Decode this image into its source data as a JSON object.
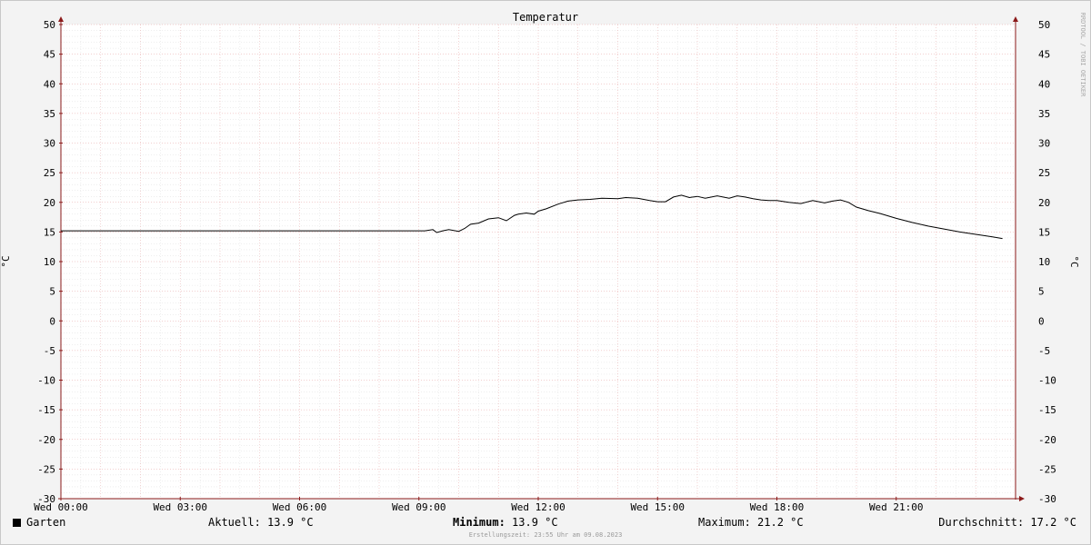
{
  "chart_data": {
    "type": "line",
    "title": "Temperatur",
    "ylabel": "°C",
    "ylabel_right": "°C",
    "ylim": [
      -30,
      50
    ],
    "yticks": [
      50,
      45,
      40,
      35,
      30,
      25,
      20,
      15,
      10,
      5,
      0,
      -5,
      -10,
      -15,
      -20,
      -25,
      -30
    ],
    "xlim_hours": [
      0,
      24
    ],
    "xticks": [
      {
        "h": 0,
        "label": "Wed 00:00"
      },
      {
        "h": 3,
        "label": "Wed 03:00"
      },
      {
        "h": 6,
        "label": "Wed 06:00"
      },
      {
        "h": 9,
        "label": "Wed 09:00"
      },
      {
        "h": 12,
        "label": "Wed 12:00"
      },
      {
        "h": 15,
        "label": "Wed 15:00"
      },
      {
        "h": 18,
        "label": "Wed 18:00"
      },
      {
        "h": 21,
        "label": "Wed 21:00"
      }
    ],
    "grid": true,
    "watermark": "RRDTOOL / TOBI OETIKER",
    "series": [
      {
        "name": "Garten",
        "color": "#000000",
        "x": [
          0,
          9.15,
          9.35,
          9.45,
          9.6,
          9.75,
          10.0,
          10.15,
          10.3,
          10.5,
          10.75,
          11.0,
          11.2,
          11.4,
          11.5,
          11.7,
          11.9,
          12.0,
          12.2,
          12.5,
          12.75,
          13.0,
          13.3,
          13.6,
          14.0,
          14.2,
          14.5,
          14.8,
          15.0,
          15.2,
          15.4,
          15.6,
          15.8,
          16.0,
          16.2,
          16.5,
          16.8,
          17.0,
          17.2,
          17.4,
          17.6,
          17.8,
          18.0,
          18.3,
          18.6,
          18.9,
          19.2,
          19.4,
          19.6,
          19.8,
          20.0,
          20.3,
          20.6,
          21.0,
          21.4,
          21.8,
          22.2,
          22.6,
          23.0,
          23.4,
          23.67
        ],
        "values": [
          15.2,
          15.2,
          15.4,
          14.9,
          15.2,
          15.4,
          15.1,
          15.6,
          16.3,
          16.5,
          17.2,
          17.4,
          16.9,
          17.8,
          18.0,
          18.2,
          18.0,
          18.5,
          18.9,
          19.7,
          20.2,
          20.4,
          20.5,
          20.7,
          20.6,
          20.8,
          20.7,
          20.3,
          20.1,
          20.1,
          20.9,
          21.2,
          20.8,
          21.0,
          20.7,
          21.1,
          20.7,
          21.1,
          20.9,
          20.6,
          20.4,
          20.3,
          20.3,
          20.0,
          19.8,
          20.3,
          19.9,
          20.2,
          20.4,
          20.0,
          19.2,
          18.6,
          18.1,
          17.3,
          16.6,
          16.0,
          15.5,
          15.0,
          14.6,
          14.2,
          13.9
        ]
      }
    ]
  },
  "legend": {
    "series_name": "Garten",
    "current": "Aktuell: 13.9 °C",
    "minimum_label": "Minimum:",
    "minimum_value": "13.9 °C",
    "maximum": "Maximum: 21.2 °C",
    "average": "Durchschnitt: 17.2 °C"
  },
  "created": "Erstellungszeit: 23:55 Uhr am 09.08.2023"
}
